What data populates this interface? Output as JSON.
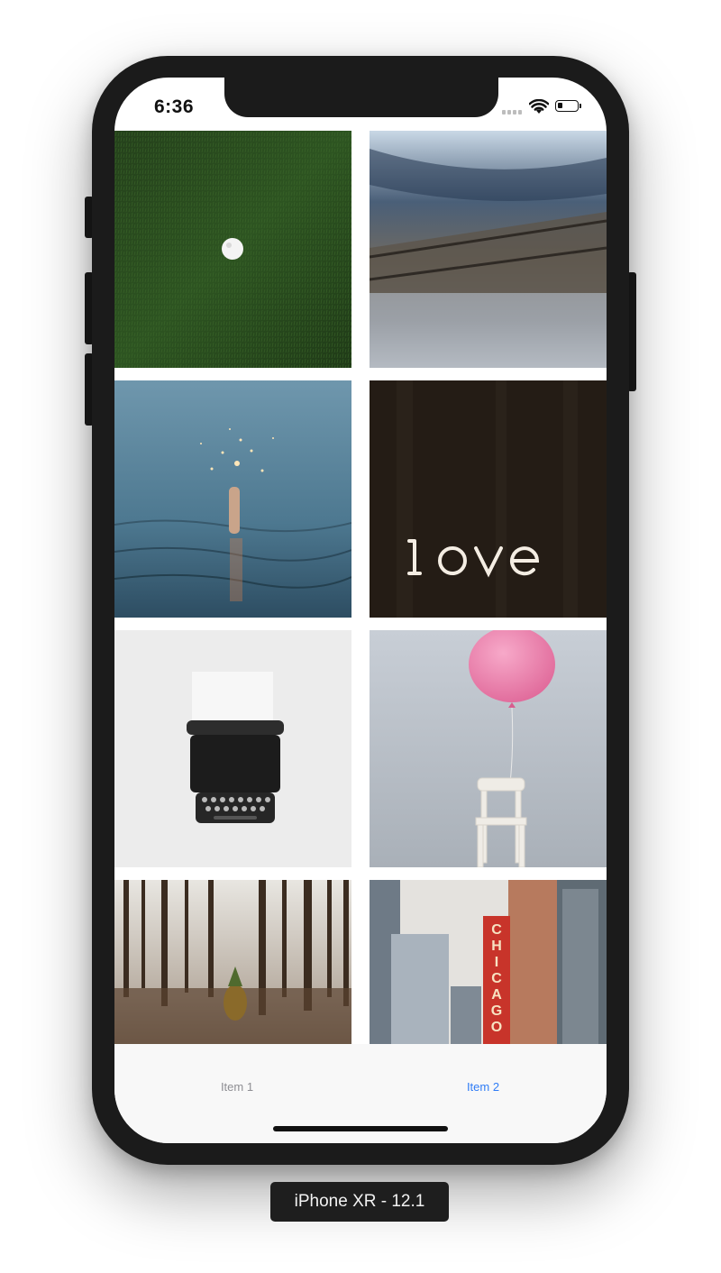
{
  "status_bar": {
    "time": "6:36",
    "icons": [
      "cellular-signal-icon",
      "wifi-icon",
      "battery-icon"
    ]
  },
  "photos": [
    {
      "subject": "golf-ball-on-grass"
    },
    {
      "subject": "blurred-railroad-track"
    },
    {
      "subject": "sparkler-hand-in-water"
    },
    {
      "subject": "love-neon-sign"
    },
    {
      "subject": "typewriter"
    },
    {
      "subject": "pink-balloon-on-chair"
    },
    {
      "subject": "pineapple-in-forest"
    },
    {
      "subject": "chicago-theatre-sign"
    }
  ],
  "tab_bar": {
    "items": [
      {
        "label": "Item 1",
        "selected": false
      },
      {
        "label": "Item 2",
        "selected": true
      }
    ],
    "selected_color": "#2f7cf6",
    "unselected_color": "#8e8e93"
  },
  "device_label": "iPhone XR - 12.1"
}
